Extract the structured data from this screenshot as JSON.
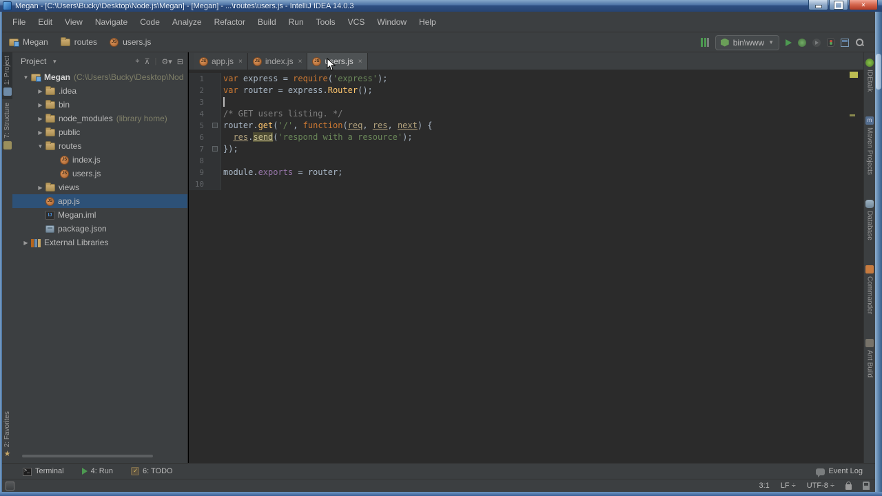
{
  "window": {
    "title": "Megan - [C:\\Users\\Bucky\\Desktop\\Node.js\\Megan] - [Megan] - ...\\routes\\users.js - IntelliJ IDEA 14.0.3"
  },
  "menubar": {
    "items": [
      "File",
      "Edit",
      "View",
      "Navigate",
      "Code",
      "Analyze",
      "Refactor",
      "Build",
      "Run",
      "Tools",
      "VCS",
      "Window",
      "Help"
    ]
  },
  "navbar": {
    "breadcrumbs": [
      {
        "label": "Megan",
        "icon": "project"
      },
      {
        "label": "routes",
        "icon": "folder"
      },
      {
        "label": "users.js",
        "icon": "js"
      }
    ],
    "run_config": "bin\\www"
  },
  "project_panel": {
    "title": "Project",
    "tree": [
      {
        "depth": 0,
        "arrow": "expanded",
        "icon": "project",
        "label": "Megan",
        "annotation": "(C:\\Users\\Bucky\\Desktop\\Nod",
        "bold": true
      },
      {
        "depth": 1,
        "arrow": "collapsed",
        "icon": "folder",
        "label": ".idea"
      },
      {
        "depth": 1,
        "arrow": "collapsed",
        "icon": "folder",
        "label": "bin"
      },
      {
        "depth": 1,
        "arrow": "collapsed",
        "icon": "folder",
        "label": "node_modules",
        "annotation": "(library home)"
      },
      {
        "depth": 1,
        "arrow": "collapsed",
        "icon": "folder",
        "label": "public"
      },
      {
        "depth": 1,
        "arrow": "expanded",
        "icon": "folder",
        "label": "routes"
      },
      {
        "depth": 2,
        "arrow": "",
        "icon": "js",
        "label": "index.js"
      },
      {
        "depth": 2,
        "arrow": "",
        "icon": "js",
        "label": "users.js"
      },
      {
        "depth": 1,
        "arrow": "collapsed",
        "icon": "folder",
        "label": "views"
      },
      {
        "depth": 1,
        "arrow": "",
        "icon": "js",
        "label": "app.js",
        "selected": true
      },
      {
        "depth": 1,
        "arrow": "",
        "icon": "iml",
        "label": "Megan.iml"
      },
      {
        "depth": 1,
        "arrow": "",
        "icon": "json",
        "label": "package.json"
      },
      {
        "depth": 0,
        "arrow": "collapsed",
        "icon": "library",
        "label": "External Libraries"
      }
    ]
  },
  "editor": {
    "tabs": [
      {
        "label": "app.js",
        "active": false
      },
      {
        "label": "index.js",
        "active": false
      },
      {
        "label": "users.js",
        "active": true
      }
    ],
    "lines": [
      {
        "num": "1",
        "segments": [
          {
            "t": "var ",
            "c": "kw"
          },
          {
            "t": "express = ",
            "c": "pl"
          },
          {
            "t": "require",
            "c": "kw"
          },
          {
            "t": "(",
            "c": "pl"
          },
          {
            "t": "'express'",
            "c": "str"
          },
          {
            "t": ");",
            "c": "pl"
          }
        ]
      },
      {
        "num": "2",
        "segments": [
          {
            "t": "var ",
            "c": "kw"
          },
          {
            "t": "router = express.",
            "c": "pl"
          },
          {
            "t": "Router",
            "c": "fn"
          },
          {
            "t": "();",
            "c": "pl"
          }
        ]
      },
      {
        "num": "3",
        "caret": true,
        "segments": []
      },
      {
        "num": "4",
        "segments": [
          {
            "t": "/* GET users listing. */",
            "c": "com"
          }
        ]
      },
      {
        "num": "5",
        "fold": true,
        "segments": [
          {
            "t": "router.",
            "c": "pl"
          },
          {
            "t": "get",
            "c": "fn"
          },
          {
            "t": "(",
            "c": "pl"
          },
          {
            "t": "'/'",
            "c": "str"
          },
          {
            "t": ", ",
            "c": "pl"
          },
          {
            "t": "function",
            "c": "kw"
          },
          {
            "t": "(",
            "c": "pl"
          },
          {
            "t": "req",
            "c": "param"
          },
          {
            "t": ", ",
            "c": "pl"
          },
          {
            "t": "res",
            "c": "param"
          },
          {
            "t": ", ",
            "c": "pl"
          },
          {
            "t": "next",
            "c": "param"
          },
          {
            "t": ") {",
            "c": "pl"
          }
        ]
      },
      {
        "num": "6",
        "segments": [
          {
            "t": "  ",
            "c": "pl"
          },
          {
            "t": "res",
            "c": "param"
          },
          {
            "t": ".",
            "c": "pl"
          },
          {
            "t": "send",
            "c": "hl"
          },
          {
            "t": "(",
            "c": "pl"
          },
          {
            "t": "'respond with a resource'",
            "c": "str"
          },
          {
            "t": ");",
            "c": "pl"
          }
        ]
      },
      {
        "num": "7",
        "fold": true,
        "segments": [
          {
            "t": "});",
            "c": "pl"
          }
        ]
      },
      {
        "num": "8",
        "segments": []
      },
      {
        "num": "9",
        "segments": [
          {
            "t": "module.",
            "c": "pl"
          },
          {
            "t": "exports",
            "c": "field"
          },
          {
            "t": " = router;",
            "c": "pl"
          }
        ]
      },
      {
        "num": "10",
        "segments": []
      }
    ]
  },
  "left_stripe": {
    "top": [
      {
        "label": "1: Project",
        "icon": "project-tool",
        "active": true
      },
      {
        "label": "7: Structure",
        "icon": "structure",
        "active": false
      }
    ],
    "bottom": [
      {
        "label": "2: Favorites",
        "icon": "favorites",
        "active": false
      }
    ]
  },
  "right_stripe": {
    "items": [
      {
        "label": "IDEtalk",
        "icon": "idetalk"
      },
      {
        "label": "Maven Projects",
        "icon": "maven"
      },
      {
        "label": "Database",
        "icon": "database"
      },
      {
        "label": "Commander",
        "icon": "commander"
      },
      {
        "label": "Ant Build",
        "icon": "ant"
      }
    ]
  },
  "bottom_bar": {
    "left": [
      {
        "label": "Terminal",
        "icon": "terminal"
      },
      {
        "label": "4: Run",
        "icon": "run"
      },
      {
        "label": "6: TODO",
        "icon": "todo"
      }
    ],
    "right": [
      {
        "label": "Event Log",
        "icon": "eventlog"
      }
    ]
  },
  "statusbar": {
    "items": [
      "3:1",
      "LF ÷",
      "UTF-8 ÷"
    ]
  }
}
